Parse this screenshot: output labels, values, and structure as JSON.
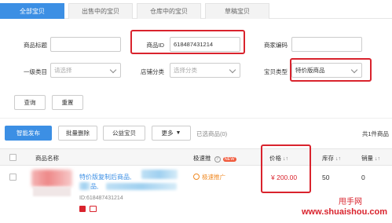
{
  "tabs": [
    "全部宝贝",
    "出售中的宝贝",
    "仓库中的宝贝",
    "草稿宝贝"
  ],
  "filters": {
    "title_label": "商品标题",
    "title_value": "",
    "id_label": "商品ID",
    "id_value": "618487431214",
    "merchant_code_label": "商家编码",
    "merchant_code_value": "",
    "category_label": "一级类目",
    "category_placeholder": "请选择",
    "shop_category_label": "店铺分类",
    "shop_category_placeholder": "选择分类",
    "item_type_label": "宝贝类型",
    "item_type_value": "特价版商品",
    "query_button": "查询",
    "reset_button": "重置"
  },
  "toolbar": {
    "smart_publish": "智能发布",
    "batch_delete": "批量删除",
    "public_item": "公益宝贝",
    "more": "更多",
    "selected_text": "已选商品(0)",
    "total_text": "共1件商品"
  },
  "table": {
    "headers": {
      "name": "商品名称",
      "promote": "极速推",
      "new_badge": "NEW",
      "price": "价格",
      "stock": "库存",
      "sales": "销量"
    },
    "rows": [
      {
        "title_line1": "特价版复制后商品,",
        "title_line2": "品,",
        "id_text": "ID:618487431214",
        "promote_link": "极速推广",
        "price": "¥ 200.00",
        "stock": "50",
        "sales": "0"
      }
    ]
  },
  "watermark": {
    "line1": "甩手网",
    "line2": "www.shuaishou.com"
  },
  "colors": {
    "accent": "#3c8fe4",
    "highlight_red": "#d9232d",
    "price_red": "#d9232d",
    "promote_orange": "#f08a24"
  }
}
